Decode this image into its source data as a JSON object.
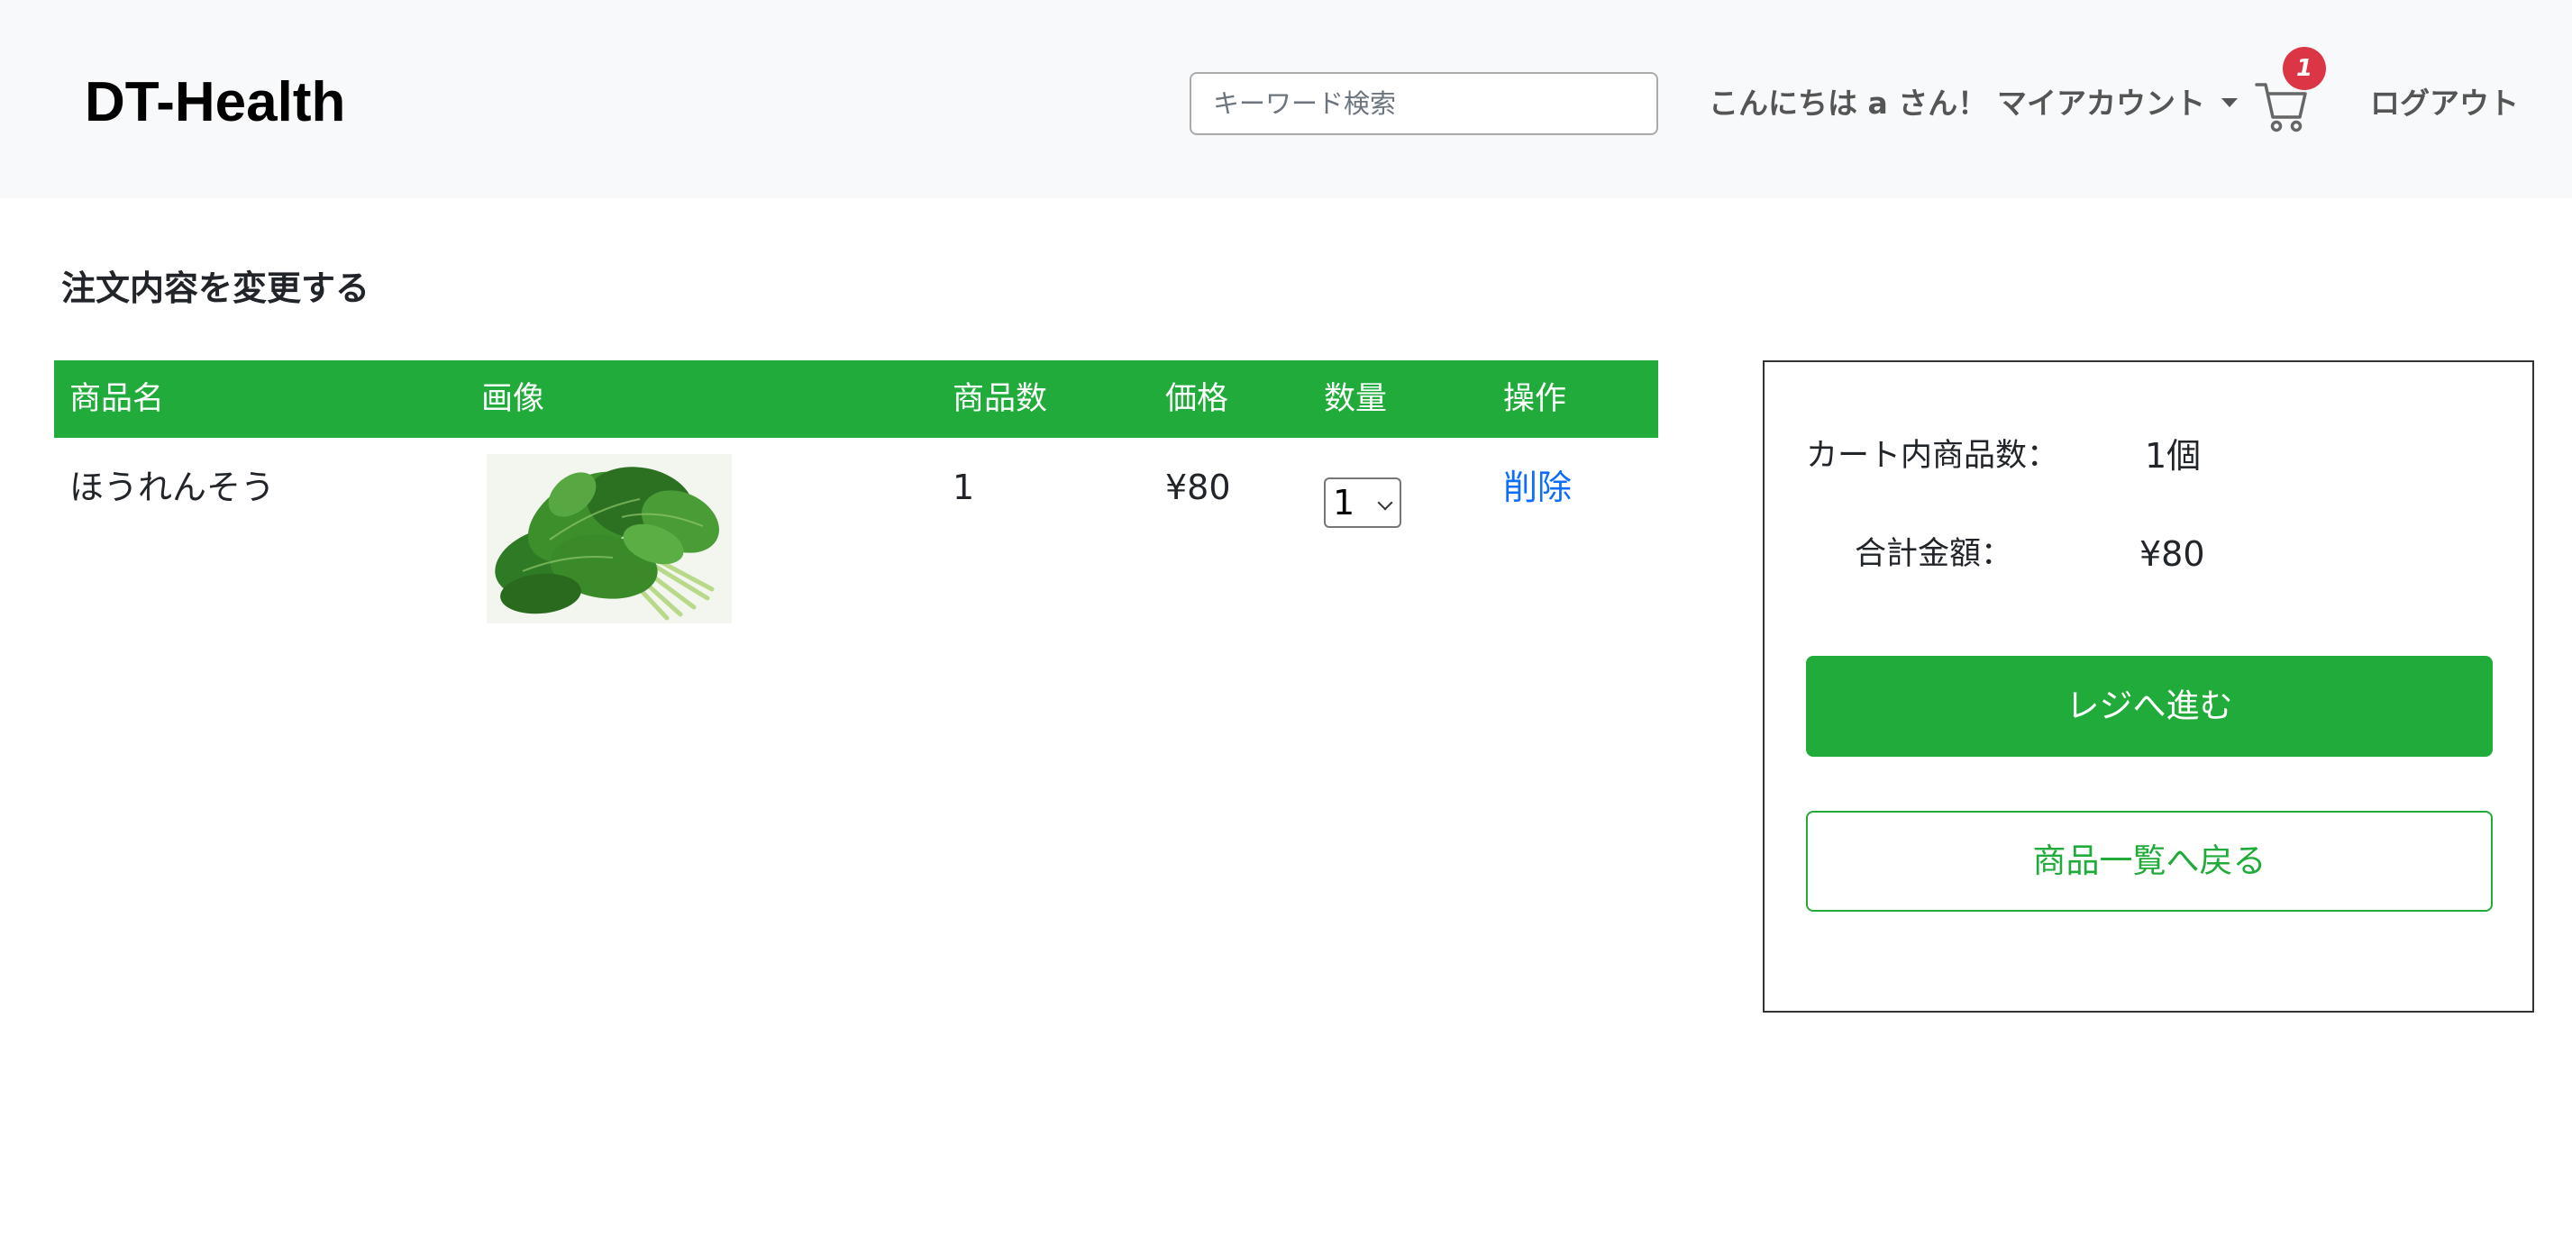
{
  "header": {
    "brand": "DT-Health",
    "search_placeholder": "キーワード検索",
    "greeting": "こんにちは a さん！",
    "account_menu": "マイアカウント",
    "cart_count": "1",
    "logout": "ログアウト"
  },
  "page": {
    "title": "注文内容を変更する"
  },
  "table": {
    "headers": [
      "商品名",
      "画像",
      "商品数",
      "価格",
      "数量",
      "操作"
    ],
    "rows": [
      {
        "name": "ほうれんそう",
        "image_alt": "spinach",
        "count": "1",
        "price": "¥80",
        "quantity": "1",
        "action": "削除"
      }
    ]
  },
  "summary": {
    "item_count_label": "カート内商品数：",
    "item_count_value": "1個",
    "total_label": "合計金額：",
    "total_value": "¥80",
    "checkout_button": "レジへ進む",
    "back_button": "商品一覧へ戻る"
  },
  "colors": {
    "primary_green": "#20ab3a",
    "badge_red": "#dc3545",
    "link_blue": "#0d6efd",
    "navbar_bg": "#f8f9fa"
  },
  "icons": {
    "cart": "shopping-cart-icon",
    "caret": "chevron-down-icon"
  }
}
